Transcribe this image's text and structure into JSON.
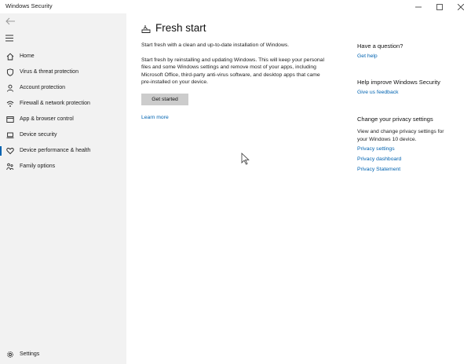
{
  "window": {
    "title": "Windows Security"
  },
  "sidebar": {
    "items": [
      {
        "label": "Home",
        "icon": "home-icon"
      },
      {
        "label": "Virus & threat protection",
        "icon": "shield-icon"
      },
      {
        "label": "Account protection",
        "icon": "person-icon"
      },
      {
        "label": "Firewall & network protection",
        "icon": "wifi-icon"
      },
      {
        "label": "App & browser control",
        "icon": "app-window-icon"
      },
      {
        "label": "Device security",
        "icon": "laptop-icon"
      },
      {
        "label": "Device performance & health",
        "icon": "heart-icon",
        "selected": true
      },
      {
        "label": "Family options",
        "icon": "family-icon"
      }
    ],
    "settings_label": "Settings"
  },
  "main": {
    "title": "Fresh start",
    "intro": "Start fresh with a clean and up-to-date installation of Windows.",
    "description": "Start fresh by reinstalling and updating Windows. This will keep your personal files and some Windows settings and remove most of your apps, including Microsoft Office, third-party anti-virus software, and desktop apps that came pre-installed on your device.",
    "button_label": "Get started",
    "learn_more": "Learn more"
  },
  "side": {
    "question_heading": "Have a question?",
    "get_help": "Get help",
    "improve_heading": "Help improve Windows Security",
    "feedback": "Give us feedback",
    "privacy_heading": "Change your privacy settings",
    "privacy_text": "View and change privacy settings for your Windows 10 device.",
    "privacy_links": [
      "Privacy settings",
      "Privacy dashboard",
      "Privacy Statement"
    ]
  },
  "colors": {
    "accent": "#0063b1",
    "sidebar_bg": "#f2f2f2",
    "button_bg": "#cccccc"
  }
}
